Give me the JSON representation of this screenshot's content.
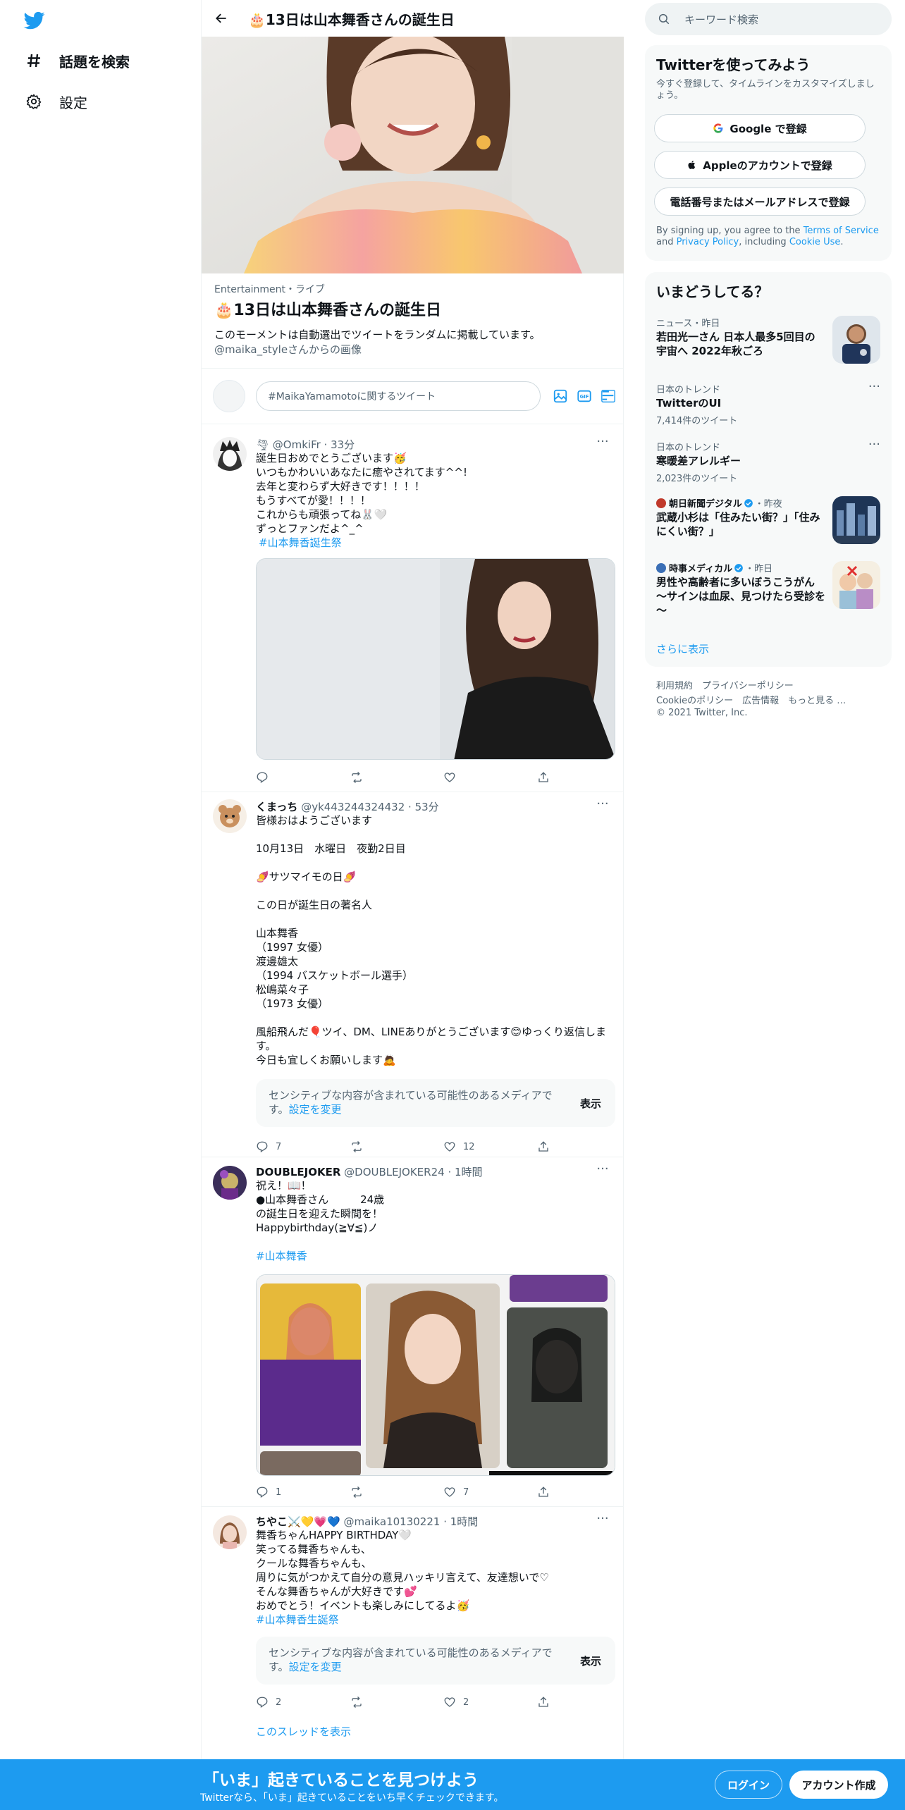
{
  "nav": {
    "explore_label": "話題を検索",
    "settings_label": "設定"
  },
  "header": {
    "title": "🎂13日は山本舞香さんの誕生日"
  },
  "moment": {
    "category": "Entertainment・ライブ",
    "title": "🎂13日は山本舞香さんの誕生日",
    "description": "このモーメントは自動選出でツイートをランダムに掲載しています。",
    "credit": "@maika_styleさんからの画像"
  },
  "compose": {
    "placeholder": "#MaikaYamamotoに関するツイート"
  },
  "tweets": [
    {
      "name": "",
      "handle_time": "🌪 @OmkiFr · 33分",
      "body": "誕生日おめでとうございます🥳\nいつもかわいいあなたに癒やされてます^^!\n去年と変わらず大好きです！！！！\nもうすべてが愛！！！！\nこれからも頑張ってね🐰🤍\nずっとファンだよ^_^",
      "hashtag": "#山本舞香誕生祭",
      "reply": "",
      "retweet": "",
      "like": ""
    },
    {
      "name": "くまっち",
      "handle_time": "@yk443244324432 · 53分",
      "body": "皆様おはようございます\n\n10月13日　水曜日　夜勤2日目\n\n🍠サツマイモの日🍠\n\nこの日が誕生日の著名人\n\n山本舞香\n（1997 女優）\n渡邊雄太\n（1994 バスケットボール選手）\n松嶋菜々子\n（1973 女優）\n\n風船飛んだ🎈ツイ、DM、LINEありがとうございます😊ゆっくり返信します。\n今日も宜しくお願いします🙇",
      "sensitive_text": "センシティブな内容が含まれている可能性のあるメディアです。",
      "sensitive_link": "設定を変更",
      "sensitive_show": "表示",
      "reply": "7",
      "retweet": "",
      "like": "12"
    },
    {
      "name": "DOUBLEJOKER",
      "handle_time": "@DOUBLEJOKER24 · 1時間",
      "body": "祝え！📖！\n●山本舞香さん　　　24歳\nの誕生日を迎えた瞬間を！\nHappybirthday(≧∀≦)ノ",
      "hashtag": "#山本舞香",
      "reply": "1",
      "retweet": "",
      "like": "7"
    },
    {
      "name": "ちやこ⚔️💛💗💙",
      "handle_time": "@maika10130221 · 1時間",
      "body": "舞香ちゃんHAPPY BIRTHDAY🤍\n笑ってる舞香ちゃんも、\nクールな舞香ちゃんも、\n周りに気がつかえて自分の意見ハッキリ言えて、友達想いで♡\nそんな舞香ちゃんが大好きです💕\nおめでとう！イベントも楽しみにしてるよ🥳",
      "hashtag": "#山本舞香生誕祭",
      "sensitive_text": "センシティブな内容が含まれている可能性のあるメディアです。",
      "sensitive_link": "設定を変更",
      "sensitive_show": "表示",
      "reply": "2",
      "retweet": "",
      "like": "2",
      "thread_link": "このスレッドを表示"
    }
  ],
  "search": {
    "placeholder": "キーワード検索"
  },
  "signup_box": {
    "title": "Twitterを使ってみよう",
    "subtitle": "今すぐ登録して、タイムラインをカスタマイズしましょう。",
    "google": "Google で登録",
    "apple": "Appleのアカウントで登録",
    "phone": "電話番号またはメールアドレスで登録",
    "legal_pre": "By signing up, you agree to the ",
    "terms": "Terms of Service",
    "and": " and ",
    "privacy": "Privacy Policy",
    "including": ", including ",
    "cookie": "Cookie Use",
    "period": "."
  },
  "trends": {
    "title": "いまどうしてる？",
    "items": [
      {
        "meta": "ニュース・昨日",
        "text": "若田光一さん 日本人最多5回目の宇宙へ 2022年秋ごろ"
      },
      {
        "meta": "日本のトレンド",
        "text": "TwitterのUI",
        "count": "7,414件のツイート"
      },
      {
        "meta": "日本のトレンド",
        "text": "寒暖差アレルギー",
        "count": "2,023件のツイート"
      },
      {
        "source": "朝日新聞デジタル",
        "time": "・昨夜",
        "text": "武蔵小杉は「住みたい街？」「住みにくい街？」"
      },
      {
        "source": "時事メディカル",
        "time": "・昨日",
        "text": "男性や高齢者に多いぼうこうがん ～サインは血尿、見つけたら受診を～"
      }
    ],
    "show_more": "さらに表示"
  },
  "footer": {
    "line1": "利用規約　プライバシーポリシー",
    "line2": "Cookieのポリシー　広告情報　もっと見る …",
    "line3": "© 2021 Twitter, Inc."
  },
  "bottom_bar": {
    "title": "「いま」起きていることを見つけよう",
    "subtitle": "Twitterなら、「いま」起きていることをいち早くチェックできます。",
    "login": "ログイン",
    "signup": "アカウント作成"
  },
  "colors": {
    "brand": "#1d9bf0",
    "text": "#0f1419",
    "secondary": "#536471"
  }
}
